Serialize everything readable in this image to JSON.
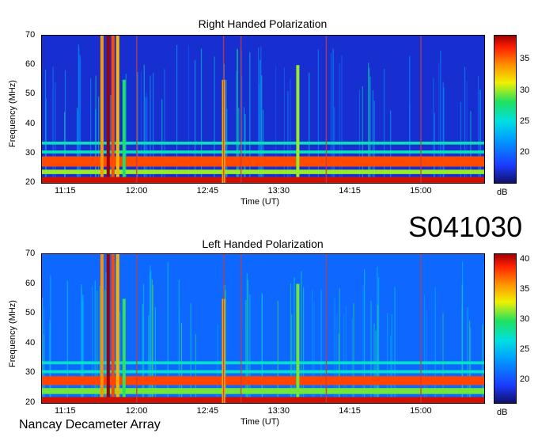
{
  "chart_data": [
    {
      "type": "heatmap",
      "title": "Right Handed Polarization",
      "xlabel": "Time (UT)",
      "ylabel": "Frequency (MHz)",
      "x_ticks": [
        "11:15",
        "12:00",
        "12:45",
        "13:30",
        "14:15",
        "15:00"
      ],
      "y_ticks": [
        "20",
        "30",
        "40",
        "50",
        "60",
        "70"
      ],
      "ylim": [
        20,
        70
      ],
      "colorbar_label": "dB",
      "colorbar_ticks": [
        "20",
        "25",
        "30",
        "35"
      ],
      "colorbar_range": [
        15,
        39
      ],
      "background_level": 17,
      "bands": [
        {
          "freq_from": 20,
          "freq_to": 22,
          "level": 38
        },
        {
          "freq_from": 25.5,
          "freq_to": 29,
          "level": 36
        },
        {
          "freq_from": 23,
          "freq_to": 24.5,
          "level": 30
        },
        {
          "freq_from": 30,
          "freq_to": 31,
          "level": 26
        },
        {
          "freq_from": 33,
          "freq_to": 34,
          "level": 26
        }
      ],
      "bursts": [
        {
          "time": "11:38",
          "freq_from": 22,
          "freq_to": 70,
          "level": 34
        },
        {
          "time": "11:42",
          "freq_from": 22,
          "freq_to": 70,
          "level": 39
        },
        {
          "time": "11:45",
          "freq_from": 22,
          "freq_to": 70,
          "level": 36
        },
        {
          "time": "11:48",
          "freq_from": 22,
          "freq_to": 70,
          "level": 33
        },
        {
          "time": "11:52",
          "freq_from": 22,
          "freq_to": 55,
          "level": 28
        },
        {
          "time": "12:55",
          "freq_from": 20,
          "freq_to": 55,
          "level": 33
        },
        {
          "time": "13:42",
          "freq_from": 22,
          "freq_to": 60,
          "level": 30
        }
      ],
      "vertical_lines": [
        "12:00",
        "12:55",
        "13:06",
        "14:00",
        "15:00"
      ]
    },
    {
      "type": "heatmap",
      "title": "Left Handed Polarization",
      "xlabel": "Time (UT)",
      "ylabel": "Frequency (MHz)",
      "x_ticks": [
        "11:15",
        "12:00",
        "12:45",
        "13:30",
        "14:15",
        "15:00"
      ],
      "y_ticks": [
        "20",
        "30",
        "40",
        "50",
        "60",
        "70"
      ],
      "ylim": [
        20,
        70
      ],
      "colorbar_label": "dB",
      "colorbar_ticks": [
        "20",
        "25",
        "30",
        "35",
        "40"
      ],
      "colorbar_range": [
        16,
        41
      ],
      "background_level": 21,
      "bands": [
        {
          "freq_from": 20,
          "freq_to": 22,
          "level": 40
        },
        {
          "freq_from": 26,
          "freq_to": 29,
          "level": 38
        },
        {
          "freq_from": 23,
          "freq_to": 25,
          "level": 31
        },
        {
          "freq_from": 30,
          "freq_to": 31,
          "level": 27
        },
        {
          "freq_from": 33,
          "freq_to": 34,
          "level": 27
        }
      ],
      "bursts": [
        {
          "time": "11:38",
          "freq_from": 22,
          "freq_to": 70,
          "level": 36
        },
        {
          "time": "11:42",
          "freq_from": 22,
          "freq_to": 70,
          "level": 41
        },
        {
          "time": "11:45",
          "freq_from": 22,
          "freq_to": 70,
          "level": 38
        },
        {
          "time": "11:48",
          "freq_from": 22,
          "freq_to": 70,
          "level": 35
        },
        {
          "time": "11:52",
          "freq_from": 22,
          "freq_to": 55,
          "level": 30
        },
        {
          "time": "12:55",
          "freq_from": 20,
          "freq_to": 55,
          "level": 35
        },
        {
          "time": "13:42",
          "freq_from": 22,
          "freq_to": 60,
          "level": 31
        }
      ],
      "vertical_lines": [
        "12:00",
        "12:55",
        "13:06",
        "14:00",
        "15:00"
      ]
    }
  ],
  "observation_id": "S041030",
  "instrument": "Nancay Decameter Array",
  "colors": {
    "low": "#10106a",
    "background": "#1a3cff",
    "mid": "#20e060",
    "high": "#ff2000",
    "max": "#a00000"
  }
}
